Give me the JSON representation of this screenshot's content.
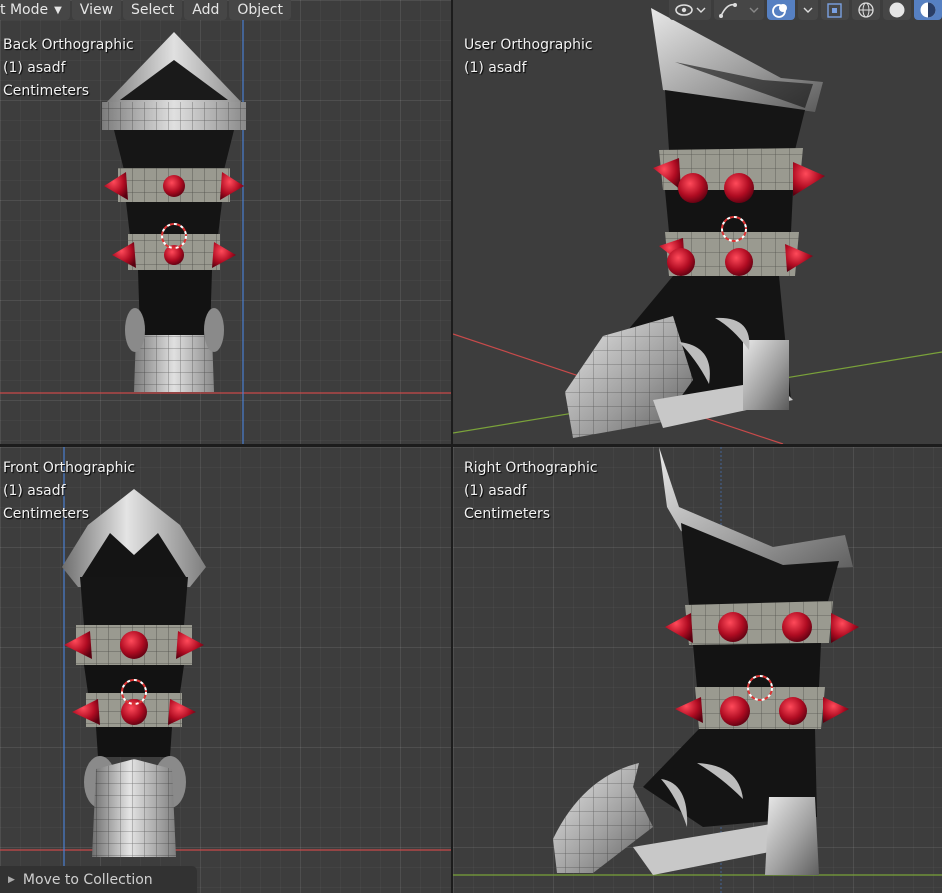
{
  "header": {
    "mode_label": "t Mode",
    "menu": [
      "View",
      "Select",
      "Add",
      "Object"
    ]
  },
  "viewports": {
    "back": {
      "view": "Back Orthographic",
      "object": "(1) asadf",
      "units": "Centimeters"
    },
    "user": {
      "view": "User Orthographic",
      "object": "(1) asadf",
      "units": "Centimeters"
    },
    "front": {
      "view": "Front Orthographic",
      "object": "(1) asadf",
      "units": "Centimeters"
    },
    "right": {
      "view": "Right Orthographic",
      "object": "(1) asadf",
      "units": "Centimeters"
    }
  },
  "tools": {
    "icons": [
      "view-object-types-icon",
      "gizmo-icon",
      "overlays-icon",
      "xray-icon",
      "shading-wireframe-icon",
      "shading-solid-icon",
      "shading-material-icon"
    ],
    "active_shading": "shading-material-icon"
  },
  "redo_panel": {
    "label": "Move to Collection"
  },
  "colors": {
    "accent": "#5680c2",
    "axis_x": "#c84a4a",
    "axis_y": "#7aa23a",
    "axis_z": "#4a7fd0",
    "boot_dark": "#1a1a1a",
    "metal": "#b8b8b8",
    "spike": "#c0122a"
  }
}
